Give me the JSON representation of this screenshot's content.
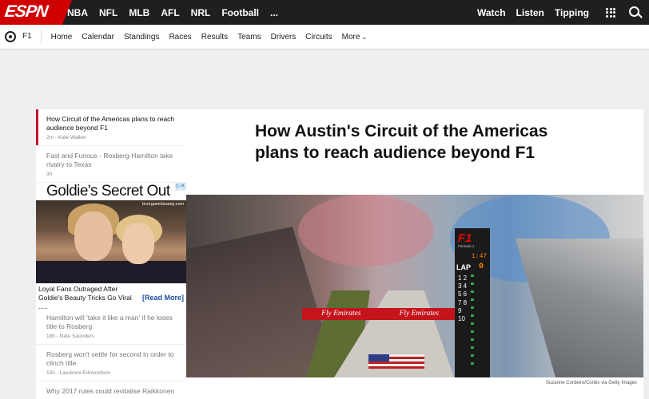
{
  "topnav": {
    "logo": "ESPN",
    "sports": [
      "NBA",
      "NFL",
      "MLB",
      "AFL",
      "NRL",
      "Football",
      "..."
    ],
    "right_links": [
      "Watch",
      "Listen",
      "Tipping"
    ]
  },
  "subnav": {
    "sport": "F1",
    "items": [
      "Home",
      "Calendar",
      "Standings",
      "Races",
      "Results",
      "Teams",
      "Drivers",
      "Circuits",
      "More"
    ]
  },
  "stories": [
    {
      "headline": "How Circuit of the Americas plans to reach audience beyond F1",
      "meta": "2m - Kate Walker"
    },
    {
      "headline": "Fast and Furious - Rosberg-Hamilton take rivalry to Texas",
      "meta": "3h"
    },
    {
      "headline": "Hamilton will 'take it like a man' if he loses title to Rosberg",
      "meta": "18h - Nate Saunders"
    },
    {
      "headline": "Rosberg won't settle for second in order to clinch title",
      "meta": "15h - Laurence Edmondson"
    },
    {
      "headline": "Why 2017 rules could revitalise Raikkonen",
      "meta": ""
    }
  ],
  "ad": {
    "title": "Goldie's Secret Out",
    "domain": "bcorganicbeauty.com",
    "text": "Loyal Fans Outraged After Goldie's Beauty Tricks Go Viral .....",
    "read_more": "[Read More]"
  },
  "article": {
    "headline": "How Austin's Circuit of the Americas plans to reach audience beyond F1",
    "credit": "Suzanne Cordeiro/Corbis via Getty Images",
    "photo": {
      "banner": [
        "Fly Emirates",
        "Fly Emirates"
      ],
      "tower_logo": "F1",
      "tower_sub": "Formula 1",
      "clock": "1:47",
      "lap_label": "LAP",
      "lap_value": "0",
      "positions": "1 2 3 4 5 6 7 8 9 10"
    }
  },
  "colors": {
    "espn_red": "#d00000",
    "topnav_bg": "#1f1f1f",
    "active_marker": "#c8102e",
    "ad_link": "#1f4fa8"
  }
}
